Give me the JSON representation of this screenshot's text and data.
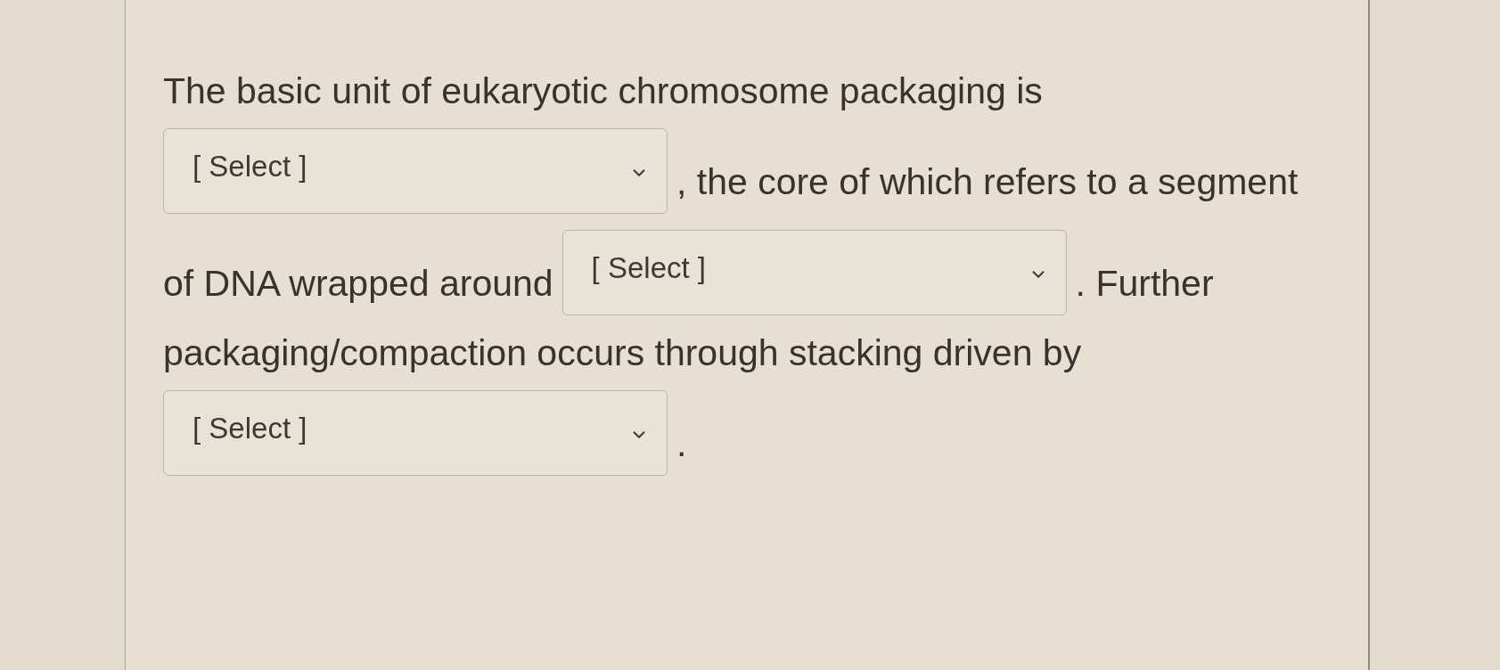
{
  "question": {
    "lines": [
      {
        "parts": [
          {
            "kind": "text",
            "text": "The basic unit of eukaryotic chromosome packaging is"
          }
        ]
      },
      {
        "parts": [
          {
            "kind": "select",
            "placeholder": "[ Select ]"
          },
          {
            "kind": "text",
            "text": ", the core of which refers to a segment"
          }
        ]
      },
      {
        "parts": [
          {
            "kind": "text",
            "text": "of DNA wrapped around"
          },
          {
            "kind": "select",
            "placeholder": "[ Select ]"
          },
          {
            "kind": "text",
            "text": ". Further"
          }
        ]
      },
      {
        "parts": [
          {
            "kind": "text",
            "text": "packaging/compaction occurs through stacking driven by"
          }
        ]
      },
      {
        "parts": [
          {
            "kind": "select",
            "placeholder": "[ Select ]"
          },
          {
            "kind": "text",
            "text": "."
          }
        ]
      }
    ]
  }
}
